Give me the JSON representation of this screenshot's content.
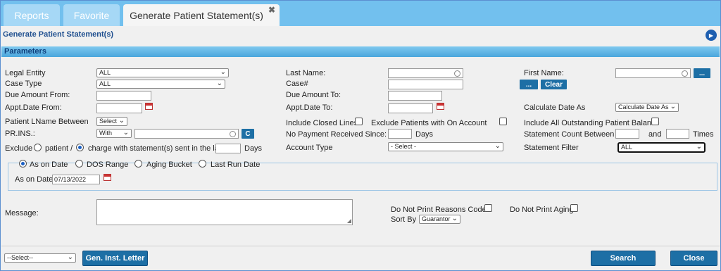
{
  "tabs": [
    {
      "label": "Reports"
    },
    {
      "label": "Favorite"
    },
    {
      "label": "Generate Patient Statement(s)"
    }
  ],
  "tab_close_glyph": "✖",
  "page_title": "Generate Patient Statement(s)",
  "params_header": "Parameters",
  "labels": {
    "legal_entity": "Legal Entity",
    "case_type": "Case Type",
    "due_amount_from": "Due Amount From:",
    "appt_date_from": "Appt.Date From:",
    "patient_lname_between": "Patient LName Between",
    "pr_ins": "PR.INS.:",
    "exclude": "Exclude",
    "patient_slash": "patient /",
    "charge_with_statement": "charge with statement(s) sent in the last",
    "days": "Days",
    "last_name": "Last Name:",
    "case_no": "Case#",
    "due_amount_to": "Due Amount To:",
    "appt_date_to": "Appt.Date To:",
    "include_closed_lines": "Include Closed Lines",
    "exclude_patients_on_account": "Exclude Patients with On Account",
    "no_payment_received": "No Payment Received Since:",
    "days2": "Days",
    "account_type": "Account Type",
    "first_name": "First Name:",
    "calculate_date_as": "Calculate Date As",
    "include_all_outstanding": "Include All Outstanding Patient Balance",
    "statement_count_between": "Statement Count Between",
    "and": "and",
    "times": "Times",
    "statement_filter": "Statement Filter",
    "as_on_date_radio": "As on Date",
    "dos_range": "DOS Range",
    "aging_bucket": "Aging Bucket",
    "last_run_date": "Last Run Date",
    "as_on_date_label": "As on Date:",
    "message": "Message:",
    "do_not_print_reasons": "Do Not Print Reasons Codes",
    "do_not_print_aging": "Do Not Print Aging",
    "sort_by": "Sort By"
  },
  "values": {
    "legal_entity": "ALL",
    "case_type": "ALL",
    "lname_select": "Select",
    "prins_select": "With",
    "account_type": "- Select -",
    "calculate_date_as": "Calculate Date As",
    "statement_filter": "ALL",
    "as_on_date": "07/13/2022",
    "sort_by": "Guarantor",
    "footer_select": "--Select--"
  },
  "buttons": {
    "first_name_ellipsis": "...",
    "case_ellipsis": "...",
    "clear": "Clear",
    "prins_c": "C",
    "gen_inst_letter": "Gen. Inst. Letter",
    "search": "Search",
    "close": "Close"
  },
  "colors": {
    "tabbar": "#72c0ee",
    "accent": "#1d6fa5",
    "title": "#1f4f8f"
  }
}
